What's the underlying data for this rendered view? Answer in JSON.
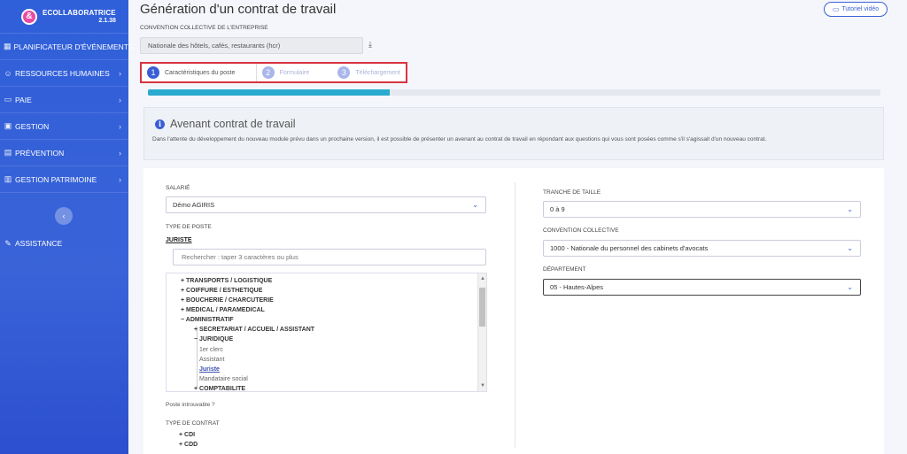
{
  "brand": {
    "logo_glyph": "&",
    "name": "ECOLLABORATRICE",
    "version": "2.1.38"
  },
  "sidebar": {
    "items": [
      {
        "icon": "calendar-icon",
        "glyph": "▦",
        "label": "PLANIFICATEUR D'ÉVÉNEMENTS",
        "chevron": ""
      },
      {
        "icon": "user-icon",
        "glyph": "☺",
        "label": "RESSOURCES HUMAINES",
        "chevron": "›"
      },
      {
        "icon": "pay-icon",
        "glyph": "▭",
        "label": "PAIE",
        "chevron": "›"
      },
      {
        "icon": "briefcase-icon",
        "glyph": "▣",
        "label": "GESTION",
        "chevron": "›"
      },
      {
        "icon": "prevention-icon",
        "glyph": "▤",
        "label": "PRÉVENTION",
        "chevron": "›"
      },
      {
        "icon": "building-icon",
        "glyph": "▥",
        "label": "GESTION PATRIMOINE",
        "chevron": "›"
      }
    ],
    "collapse_glyph": "‹",
    "assist_glyph": "✎",
    "assist_label": "ASSISTANCE"
  },
  "header": {
    "title": "Génération d'un contrat de travail",
    "tutorial_glyph": "▭",
    "tutorial_label": "Tutoriel vidéo"
  },
  "convention": {
    "label": "CONVENTION COLLECTIVE DE L'ENTREPRISE",
    "value": "Nationale des hôtels, cafés, restaurants (hcr)",
    "download_glyph": "⤓"
  },
  "steps": [
    {
      "num": "1",
      "label": "Caractéristiques du poste"
    },
    {
      "num": "2",
      "label": "Formulaire"
    },
    {
      "num": "3",
      "label": "Téléchargement"
    }
  ],
  "progress": {
    "fraction": 0.33
  },
  "notice": {
    "icon_glyph": "i",
    "title": "Avenant contrat de travail",
    "text": "Dans l'attente du développement du nouveau module prévu dans un prochaine version, il est possible de présenter un avenant au contrat de travail en répondant aux questions qui vous sont posées comme s'il s'agissait d'un nouveau contrat."
  },
  "form": {
    "chevron_glyph": "⌄",
    "salarie_label": "SALARIÉ",
    "salarie_value": "Démo AGIRIS",
    "type_poste_label": "TYPE DE POSTE",
    "selected_job": "JURISTE",
    "search_placeholder": "Rechercher : taper 3 caractères ou plus",
    "tree": [
      "+ TRANSPORTS / LOGISTIQUE",
      "+ COIFFURE / ESTHETIQUE",
      "+ BOUCHERIE / CHARCUTERIE",
      "+ MEDICAL / PARAMEDICAL",
      "− ADMINISTRATIF",
      "+ SECRETARIAT / ACCUEIL / ASSISTANT",
      "− JURIDIQUE",
      "1er clerc",
      "Assistant",
      "Juriste",
      "Mandataire social",
      "+ COMPTABILITE"
    ],
    "scroll_up_glyph": "▲",
    "scroll_down_glyph": "▼",
    "not_found": "Poste introuvable ?",
    "type_contrat_label": "TYPE DE CONTRAT",
    "contracts": [
      "+ CDI",
      "+ CDD"
    ],
    "tranche_label": "TRANCHE DE TAILLE",
    "tranche_value": "0 à 9",
    "cc_label": "CONVENTION COLLECTIVE",
    "cc_value": "1000 - Nationale du personnel des cabinets d'avocats",
    "dept_label": "DÉPARTEMENT",
    "dept_value": "05 - Hautes-Alpes"
  }
}
